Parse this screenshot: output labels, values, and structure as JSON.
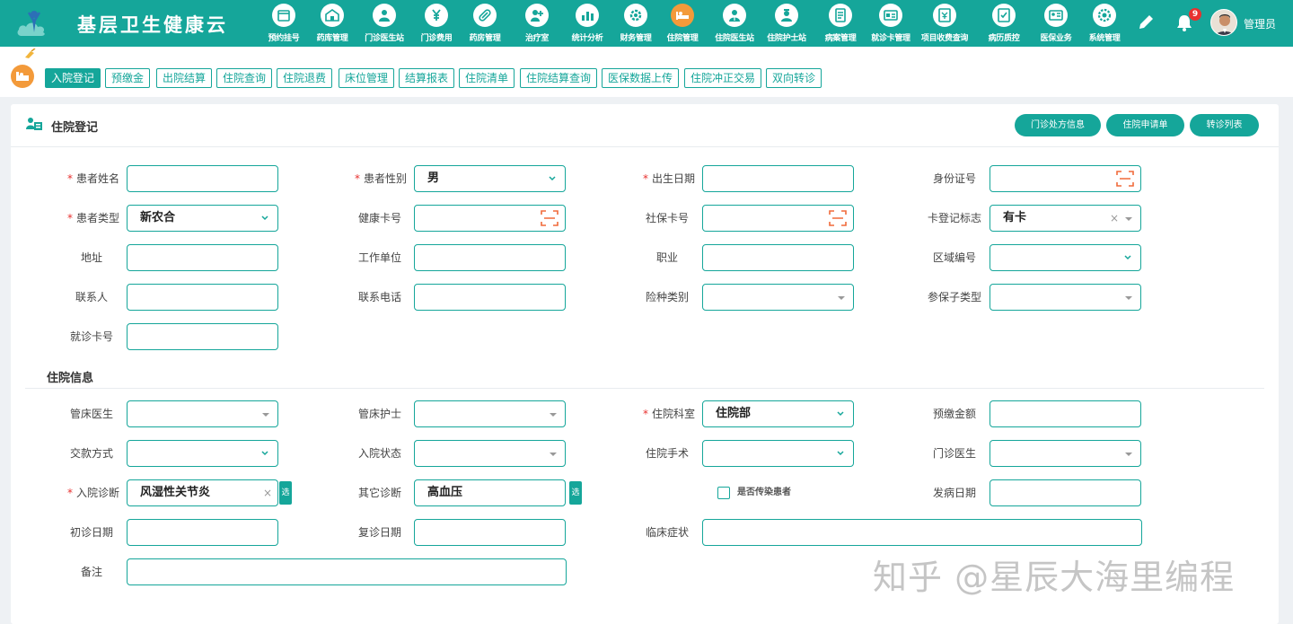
{
  "header": {
    "brand": "基层卫生健康云",
    "nav": [
      {
        "label": "预约挂号",
        "icon": "calendar-icon"
      },
      {
        "label": "药库管理",
        "icon": "warehouse-icon"
      },
      {
        "label": "门诊医生站",
        "icon": "doctor-icon"
      },
      {
        "label": "门诊费用",
        "icon": "yuan-icon"
      },
      {
        "label": "药房管理",
        "icon": "pill-icon"
      },
      {
        "label": "治疗室",
        "icon": "treatment-icon"
      },
      {
        "label": "统计分析",
        "icon": "bar-chart-icon"
      },
      {
        "label": "财务管理",
        "icon": "finance-gear-icon"
      },
      {
        "label": "住院管理",
        "icon": "bed-icon"
      },
      {
        "label": "住院医生站",
        "icon": "inpatient-doctor-icon"
      },
      {
        "label": "住院护士站",
        "icon": "nurse-icon"
      },
      {
        "label": "病案管理",
        "icon": "medical-record-icon"
      },
      {
        "label": "就诊卡管理",
        "icon": "card-icon"
      },
      {
        "label": "项目收费查询",
        "icon": "fee-query-icon"
      },
      {
        "label": "病历质控",
        "icon": "quality-control-icon"
      },
      {
        "label": "医保业务",
        "icon": "insurance-icon"
      },
      {
        "label": "系统管理",
        "icon": "settings-icon"
      }
    ],
    "active_nav": 8,
    "notification_count": "9",
    "user_name": "管理员"
  },
  "tabs": [
    "入院登记",
    "预缴金",
    "出院结算",
    "住院查询",
    "住院退费",
    "床位管理",
    "结算报表",
    "住院清单",
    "住院结算查询",
    "医保数据上传",
    "住院冲正交易",
    "双向转诊"
  ],
  "panel": {
    "title": "住院登记",
    "buttons": [
      "门诊处方信息",
      "住院申请单",
      "转诊列表"
    ]
  },
  "form": {
    "name": {
      "label": "患者姓名",
      "value": ""
    },
    "gender": {
      "label": "患者性别",
      "value": "男"
    },
    "birth": {
      "label": "出生日期",
      "value": ""
    },
    "id_card": {
      "label": "身份证号",
      "value": ""
    },
    "patient_type": {
      "label": "患者类型",
      "value": "新农合"
    },
    "health_card": {
      "label": "健康卡号",
      "value": ""
    },
    "social_card": {
      "label": "社保卡号",
      "value": ""
    },
    "card_flag": {
      "label": "卡登记标志",
      "value": "有卡"
    },
    "address": {
      "label": "地址",
      "value": ""
    },
    "work_unit": {
      "label": "工作单位",
      "value": ""
    },
    "occupation": {
      "label": "职业",
      "value": ""
    },
    "region_code": {
      "label": "区域编号",
      "value": ""
    },
    "contact": {
      "label": "联系人",
      "value": ""
    },
    "phone": {
      "label": "联系电话",
      "value": ""
    },
    "insurance_type": {
      "label": "险种类别",
      "value": ""
    },
    "insurance_subtype": {
      "label": "参保子类型",
      "value": ""
    },
    "visit_card": {
      "label": "就诊卡号",
      "value": ""
    }
  },
  "hospital_section_title": "住院信息",
  "hospital": {
    "bed_doctor": {
      "label": "管床医生",
      "value": ""
    },
    "bed_nurse": {
      "label": "管床护士",
      "value": ""
    },
    "department": {
      "label": "住院科室",
      "value": "住院部"
    },
    "deposit": {
      "label": "预缴金额",
      "value": ""
    },
    "payment": {
      "label": "交款方式",
      "value": ""
    },
    "admission_state": {
      "label": "入院状态",
      "value": ""
    },
    "surgery": {
      "label": "住院手术",
      "value": ""
    },
    "outpatient_doctor": {
      "label": "门诊医生",
      "value": ""
    },
    "diagnosis": {
      "label": "入院诊断",
      "value": "风湿性关节炎"
    },
    "other_diagnosis": {
      "label": "其它诊断",
      "value": "高血压"
    },
    "infectious": {
      "label": "是否传染患者"
    },
    "onset_date": {
      "label": "发病日期",
      "value": ""
    },
    "first_visit": {
      "label": "初诊日期",
      "value": ""
    },
    "revisit": {
      "label": "复诊日期",
      "value": ""
    },
    "symptoms": {
      "label": "临床症状",
      "value": ""
    },
    "remark": {
      "label": "备注",
      "value": ""
    }
  },
  "select_btn": "选",
  "watermark": "知乎 @星辰大海里编程",
  "colors": {
    "primary": "#15a69a",
    "accent": "#f39a3a",
    "required": "#e8312f",
    "scan": "#f06a3a"
  }
}
